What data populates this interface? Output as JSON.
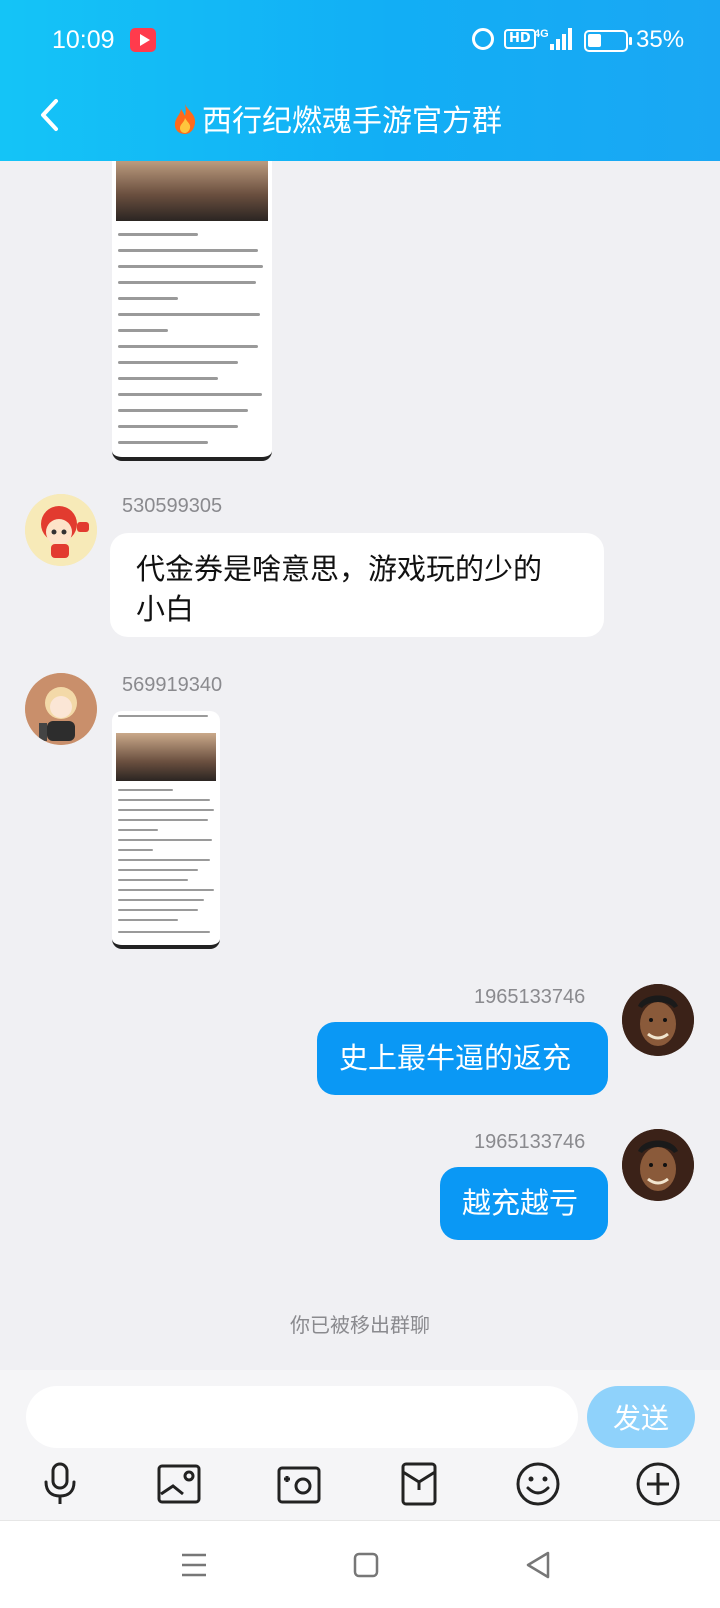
{
  "status_bar": {
    "time": "10:09",
    "battery_percent": "35%",
    "network": "4G",
    "hd_label": "HD"
  },
  "header": {
    "title": "西行纪燃魂手游官方群"
  },
  "messages": [
    {
      "sender": "530599305",
      "type": "text",
      "direction": "in",
      "text": "代金券是啥意思，游戏玩的少的\n小白"
    },
    {
      "sender": "569919340",
      "type": "image",
      "direction": "in"
    },
    {
      "sender": "1965133746",
      "type": "text",
      "direction": "out",
      "text": "史上最牛逼的返充"
    },
    {
      "sender": "1965133746",
      "type": "text",
      "direction": "out",
      "text": "越充越亏"
    }
  ],
  "system_note": "你已被移出群聊",
  "input": {
    "placeholder": "",
    "send_label": "发送"
  },
  "toolbar": [
    "microphone-icon",
    "image-icon",
    "camera-icon",
    "red-packet-icon",
    "emoji-icon",
    "plus-icon"
  ],
  "colors": {
    "header": "#12aef5",
    "outgoing_bubble": "#0a98f5",
    "send_button": "#8fd2fb",
    "background": "#f0f0f3"
  }
}
